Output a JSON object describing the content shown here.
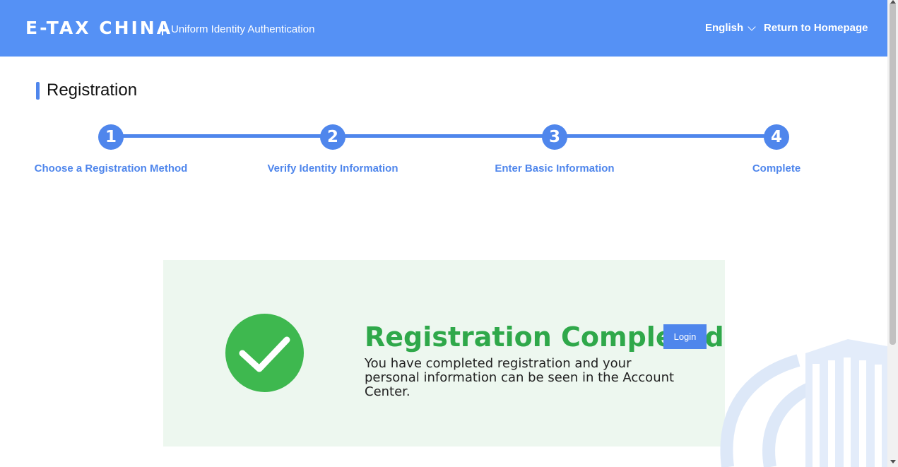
{
  "header": {
    "brand": "E-TAX CHINA",
    "subtitle": "Uniform Identity Authentication",
    "language": "English",
    "return_home": "Return to Homepage"
  },
  "page": {
    "title": "Registration"
  },
  "steps": [
    {
      "number": "1",
      "label": "Choose a Registration Method"
    },
    {
      "number": "2",
      "label": "Verify Identity Information"
    },
    {
      "number": "3",
      "label": "Enter Basic Information"
    },
    {
      "number": "4",
      "label": "Complete"
    }
  ],
  "result": {
    "title": "Registration Completed",
    "login_label": "Login",
    "description": "You have completed registration and your personal information can be seen in the Account Center."
  },
  "colors": {
    "header": "#5591f5",
    "accent": "#4f86ec",
    "success": "#3eb84f",
    "panel": "#edf7ef"
  },
  "icons": [
    "chevron-down-icon",
    "checkmark-icon",
    "building-watermark-icon"
  ]
}
